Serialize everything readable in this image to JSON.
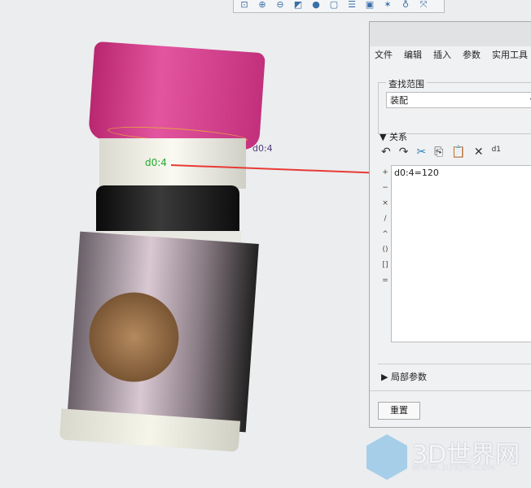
{
  "toolbar": {
    "icons": [
      "zoom-fit-icon",
      "zoom-in-icon",
      "zoom-out-icon",
      "view-orient-icon",
      "display-style-icon",
      "saved-views-icon",
      "layers-icon",
      "camera-icon",
      "spin-center-icon",
      "datum-display-icon",
      "annotation-icon"
    ]
  },
  "model": {
    "dimension_label": "d0:4",
    "dimension_label_2": "d0:4"
  },
  "panel": {
    "menu": [
      "文件",
      "编辑",
      "插入",
      "参数",
      "实用工具"
    ],
    "scope_label": "查找范围",
    "scope_value": "装配",
    "relations_label": "关系",
    "operators": [
      "+",
      "−",
      "×",
      "/",
      "^",
      "()",
      "[]",
      "="
    ],
    "relation_text": "d0:4=120",
    "local_params_label": "局部参数",
    "reset_label": "重置"
  },
  "watermark": {
    "title": "3D世界网",
    "url": "WWW.3DSJW.COM"
  },
  "colors": {
    "cap": "#d63c8f",
    "arrow": "#e83a35",
    "dimension": "#1faa2a"
  }
}
